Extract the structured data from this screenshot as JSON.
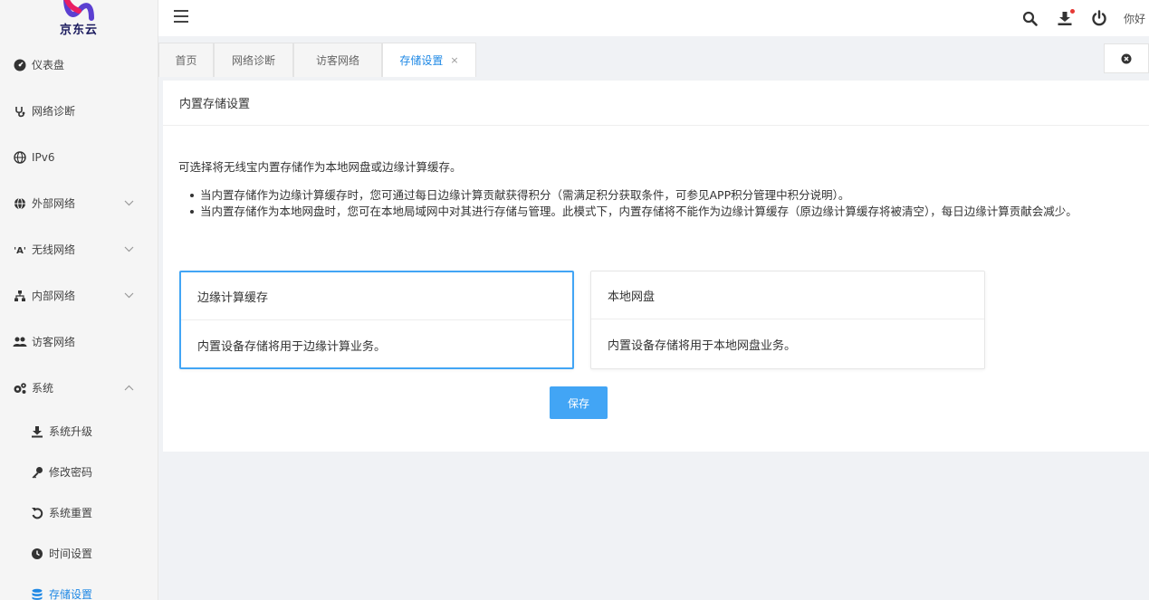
{
  "brand": {
    "name": "京东云"
  },
  "sidebar": {
    "items": [
      {
        "label": "仪表盘",
        "icon": "dashboard-icon"
      },
      {
        "label": "网络诊断",
        "icon": "stethoscope-icon"
      },
      {
        "label": "IPv6",
        "icon": "globe-icon"
      },
      {
        "label": "外部网络",
        "icon": "globe-icon",
        "expand": "collapsed"
      },
      {
        "label": "无线网络",
        "icon": "wifi-icon",
        "expand": "collapsed"
      },
      {
        "label": "内部网络",
        "icon": "sitemap-icon",
        "expand": "collapsed"
      },
      {
        "label": "访客网络",
        "icon": "users-icon"
      },
      {
        "label": "系统",
        "icon": "cogs-icon",
        "expand": "expanded"
      }
    ],
    "subitems": [
      {
        "label": "系统升级",
        "icon": "download-icon"
      },
      {
        "label": "修改密码",
        "icon": "key-icon"
      },
      {
        "label": "系统重置",
        "icon": "undo-icon"
      },
      {
        "label": "时间设置",
        "icon": "clock-icon"
      },
      {
        "label": "存储设置",
        "icon": "database-icon",
        "active": true
      }
    ]
  },
  "header": {
    "greeting": "你好",
    "icons": [
      "search-icon",
      "download-icon",
      "power-icon"
    ]
  },
  "tabs": [
    {
      "label": "首页"
    },
    {
      "label": "网络诊断"
    },
    {
      "label": "访客网络"
    },
    {
      "label": "存储设置",
      "active": true,
      "close": "×"
    }
  ],
  "content": {
    "title": "内置存储设置",
    "intro": "可选择将无线宝内置存储作为本地网盘或边缘计算缓存。",
    "bullets": [
      "当内置存储作为边缘计算缓存时，您可通过每日边缘计算贡献获得积分（需满足积分获取条件，可参见APP积分管理中积分说明）。",
      "当内置存储作为本地网盘时，您可在本地局域网中对其进行存储与管理。此模式下，内置存储将不能作为边缘计算缓存（原边缘计算缓存将被清空），每日边缘计算贡献会减少。"
    ],
    "options": [
      {
        "title": "边缘计算缓存",
        "desc": "内置设备存储将用于边缘计算业务。",
        "selected": true
      },
      {
        "title": "本地网盘",
        "desc": "内置设备存储将用于本地网盘业务。",
        "selected": false
      }
    ],
    "save_label": "保存"
  },
  "colors": {
    "accent": "#42a5f5",
    "active_text": "#1e88e5"
  }
}
